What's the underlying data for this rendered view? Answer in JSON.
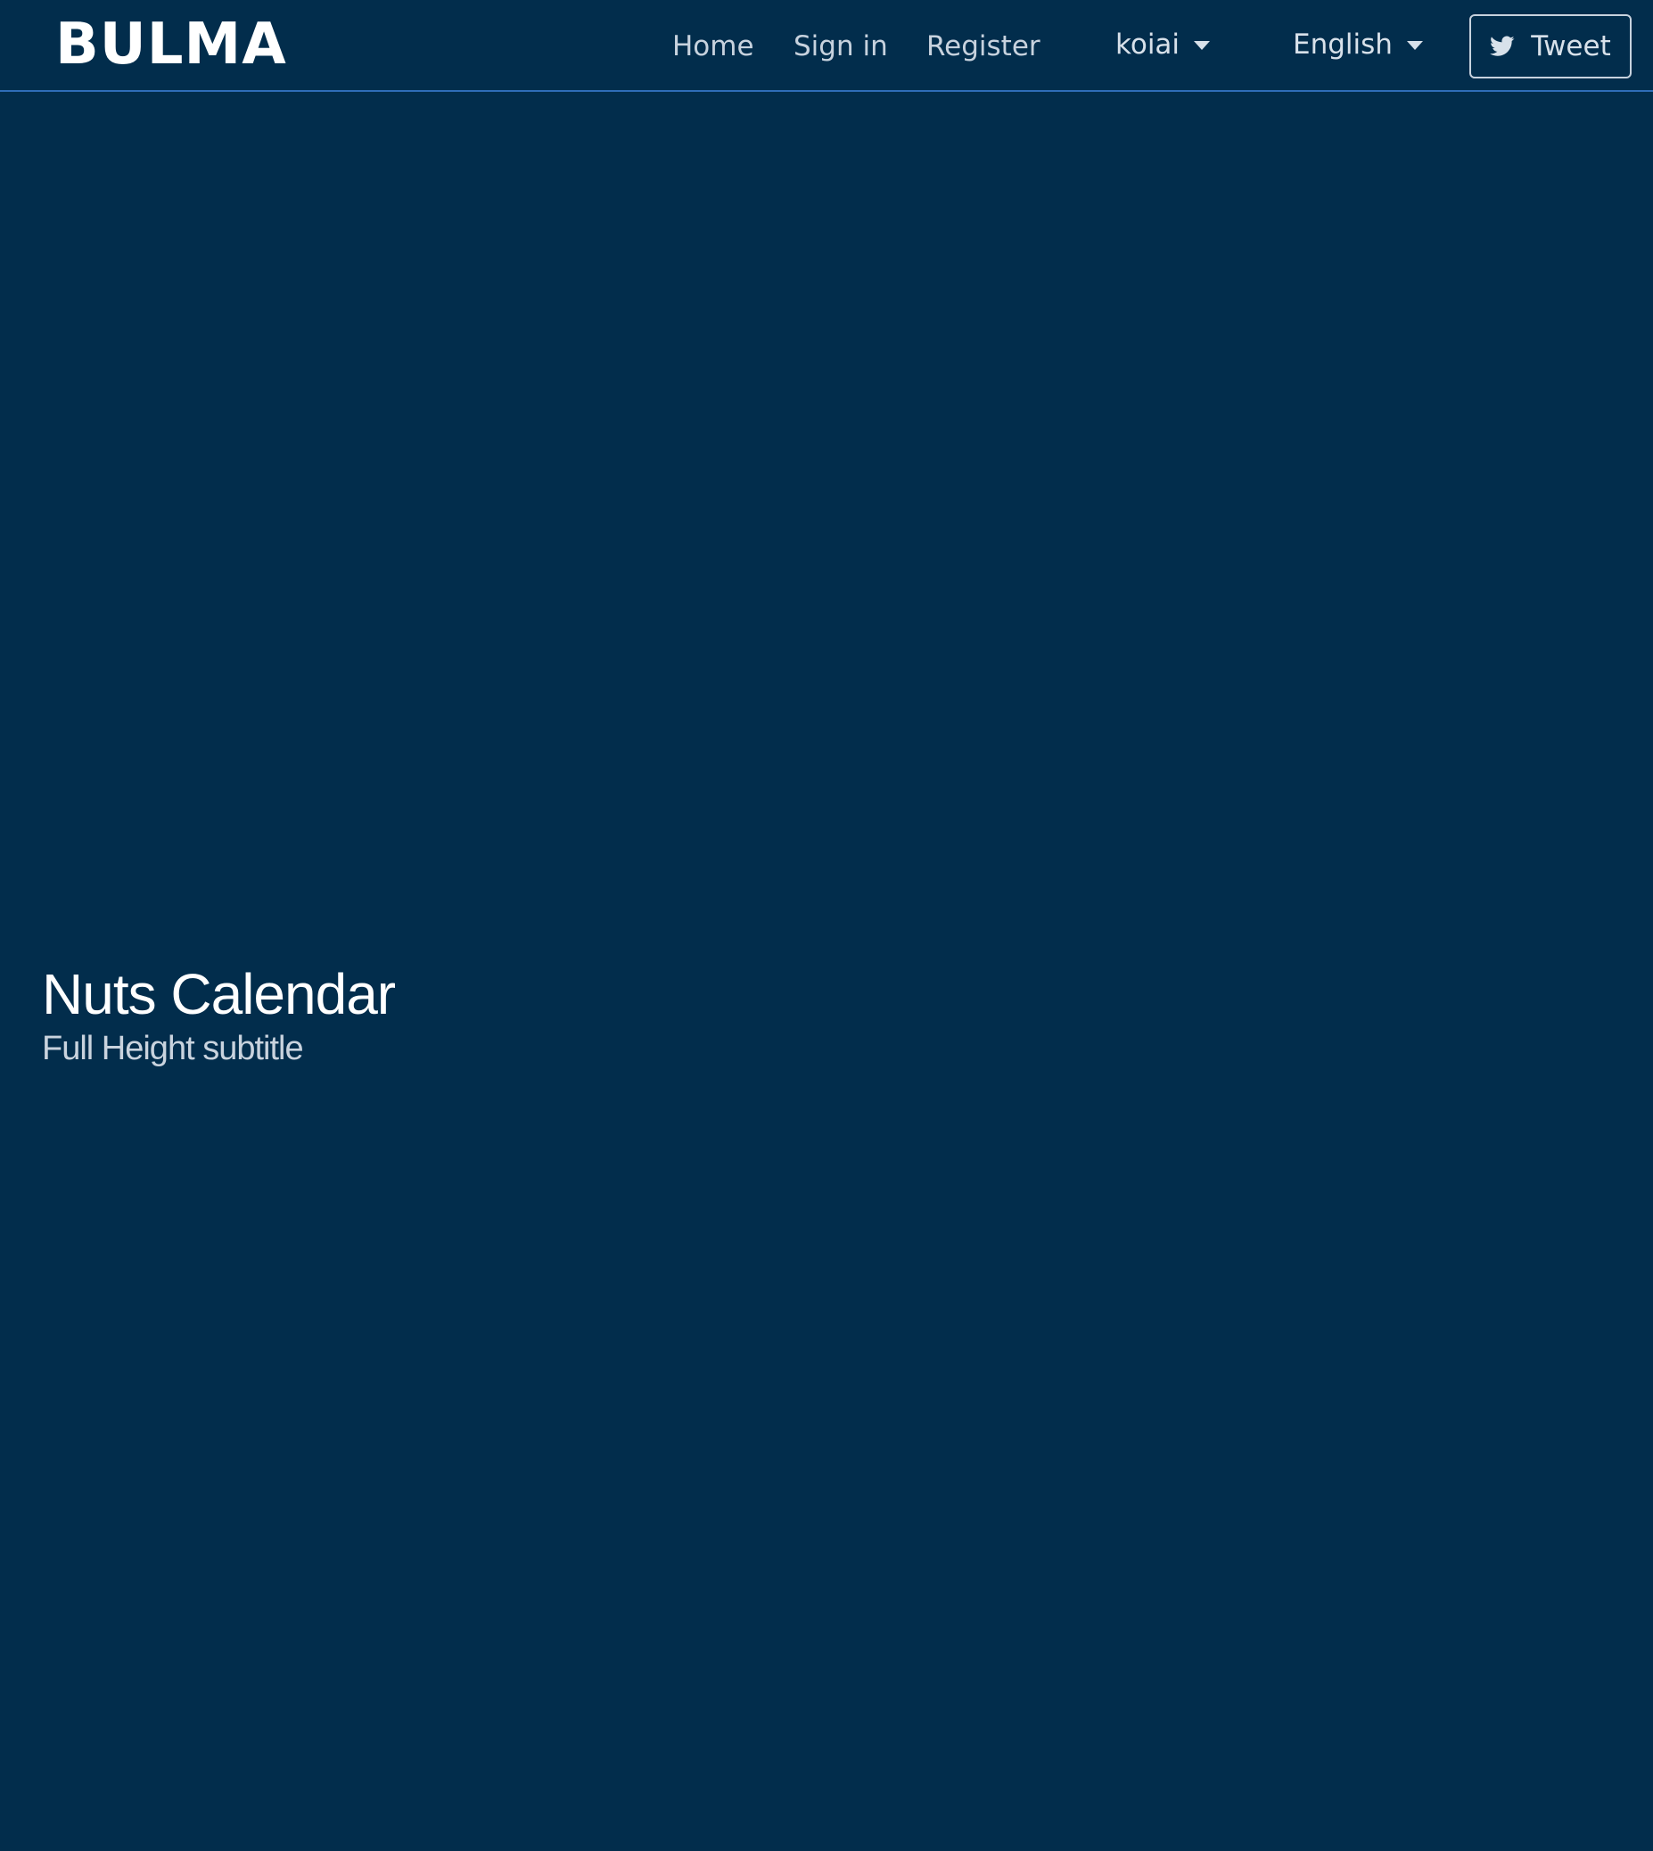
{
  "navbar": {
    "brand": "BULMA",
    "links": [
      {
        "label": "Home"
      },
      {
        "label": "Sign in"
      },
      {
        "label": "Register"
      }
    ],
    "user_menu": {
      "label": "koiai"
    },
    "language_menu": {
      "label": "English"
    },
    "tweet_button": {
      "label": "Tweet",
      "icon": "twitter-icon"
    }
  },
  "hero": {
    "title": "Nuts Calendar",
    "subtitle": "Full Height subtitle"
  },
  "colors": {
    "background": "#022d4c",
    "navbar_border": "#2f6db8",
    "text_primary": "#ffffff",
    "text_secondary": "#c7d2de"
  }
}
